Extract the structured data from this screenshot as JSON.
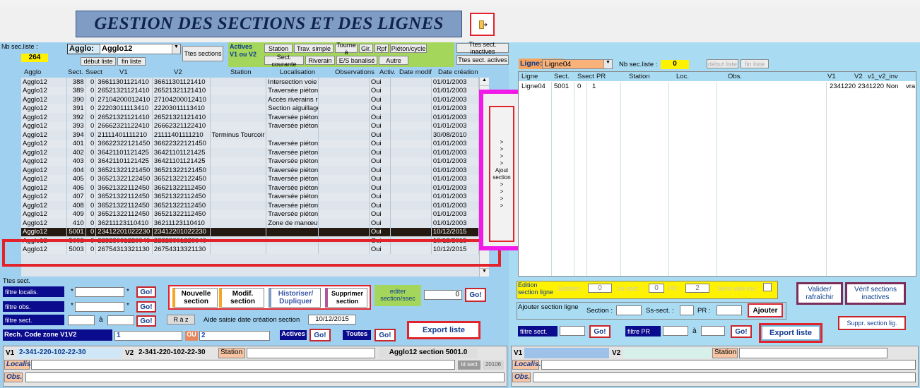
{
  "title": "GESTION DES SECTIONS ET DES LIGNES",
  "left": {
    "nb_label": "Nb sec.liste :",
    "nb_value": "264",
    "agglo_label": "Agglo:",
    "agglo_value": "Agglo12",
    "debut": "début liste",
    "fin": "fin liste",
    "ttes_sections": "Ttes sections",
    "actives_label": "Actives\nV1 ou V2",
    "filters1": [
      "Station",
      "Trav. simple",
      "Tourne à",
      "Gir.",
      "Rpf",
      "Piéton/cycle"
    ],
    "filters2": [
      "Sect. courante",
      "Riverain",
      "E/S banalisé",
      "Autre"
    ],
    "ttes_inactives": "Ttes sect. inactives",
    "ttes_actives": "Ttes sect. actives",
    "headers": [
      "Agglo",
      "Sect.",
      "Ssect",
      "V1",
      "V2",
      "Station",
      "Localisation",
      "Observations",
      "Activ.",
      "Date modif",
      "Date création"
    ],
    "rows": [
      [
        "Agglo12",
        "388",
        "0",
        "36611301121410",
        "36611301121410",
        "",
        "Intersection voie c",
        "",
        "Oui",
        "",
        "01/01/2003"
      ],
      [
        "Agglo12",
        "389",
        "0",
        "26521321121410",
        "26521321121410",
        "",
        "Traversée piétonr",
        "",
        "Oui",
        "",
        "01/01/2003"
      ],
      [
        "Agglo12",
        "390",
        "0",
        "27104200012410",
        "27104200012410",
        "",
        "Accès riverains ru",
        "",
        "Oui",
        "",
        "01/01/2003"
      ],
      [
        "Agglo12",
        "391",
        "0",
        "22203011113410",
        "22203011113410",
        "",
        "Section aiguillage",
        "",
        "Oui",
        "",
        "01/01/2003"
      ],
      [
        "Agglo12",
        "392",
        "0",
        "26521321121410",
        "26521321121410",
        "",
        "Traversée piétonr",
        "",
        "Oui",
        "",
        "01/01/2003"
      ],
      [
        "Agglo12",
        "393",
        "0",
        "26662321122410",
        "26662321122410",
        "",
        "Traversée piétonr",
        "",
        "Oui",
        "",
        "01/01/2003"
      ],
      [
        "Agglo12",
        "394",
        "0",
        "21111401111210",
        "21111401111210",
        "Terminus Tourcoir",
        "",
        "",
        "Oui",
        "",
        "30/08/2010"
      ],
      [
        "Agglo12",
        "401",
        "0",
        "36622322121450",
        "36622322121450",
        "",
        "Traversée piétonr",
        "",
        "Oui",
        "",
        "01/01/2003"
      ],
      [
        "Agglo12",
        "402",
        "0",
        "36421101121425",
        "36421101121425",
        "",
        "Traversée piétonr",
        "",
        "Oui",
        "",
        "01/01/2003"
      ],
      [
        "Agglo12",
        "403",
        "0",
        "36421101121425",
        "36421101121425",
        "",
        "Traversée piétonr",
        "",
        "Oui",
        "",
        "01/01/2003"
      ],
      [
        "Agglo12",
        "404",
        "0",
        "36521322121450",
        "36521322121450",
        "",
        "Traversée piétonr",
        "",
        "Oui",
        "",
        "01/01/2003"
      ],
      [
        "Agglo12",
        "405",
        "0",
        "36521322122450",
        "36521322122450",
        "",
        "Traversée piétonr",
        "",
        "Oui",
        "",
        "01/01/2003"
      ],
      [
        "Agglo12",
        "406",
        "0",
        "36621322112450",
        "36621322112450",
        "",
        "Traversée piétonr",
        "",
        "Oui",
        "",
        "01/01/2003"
      ],
      [
        "Agglo12",
        "407",
        "0",
        "36521322112450",
        "36521322112450",
        "",
        "Traversée piétonr",
        "",
        "Oui",
        "",
        "01/01/2003"
      ],
      [
        "Agglo12",
        "408",
        "0",
        "36521322112450",
        "36521322112450",
        "",
        "Traversée piétonr",
        "",
        "Oui",
        "",
        "01/01/2003"
      ],
      [
        "Agglo12",
        "409",
        "0",
        "36521322112450",
        "36521322112450",
        "",
        "Traversée piétonr",
        "",
        "Oui",
        "",
        "01/01/2003"
      ],
      [
        "Agglo12",
        "410",
        "0",
        "36211123110410",
        "36211123110410",
        "",
        "Zone de manœuv",
        "",
        "Oui",
        "",
        "01/01/2003"
      ],
      [
        "Agglo12",
        "5001",
        "0",
        "23412201022230",
        "23412201022230",
        "",
        "",
        "",
        "Oui",
        "",
        "10/12/2015"
      ],
      [
        "Agglo12",
        "5002",
        "0",
        "22323001220040",
        "22323001220040",
        "",
        "",
        "",
        "Oui",
        "",
        "10/12/2015"
      ],
      [
        "Agglo12",
        "5003",
        "0",
        "26754313321130",
        "26754313321130",
        "",
        "",
        "",
        "Oui",
        "",
        "10/12/2015"
      ]
    ],
    "ttes_sect": "Ttes sect.",
    "filtre_localis": "filtre localis.",
    "filtre_obs": "filtre obs.",
    "filtre_sect": "filtre sect.",
    "star": "*",
    "a": "à",
    "go": "Go!",
    "nouvelle": "Nouvelle\nsection",
    "modif": "Modif.\nsection",
    "historiser": "Historiser/\nDupliquer",
    "supprimer": "Supprimer\nsection",
    "editer": "editer\nsection/ssec",
    "editer_value": "0",
    "raz": "R à z",
    "aide": "Aide saisie date création section",
    "aide_date": "10/12/2015",
    "rech": "Rech. Code zone V1V2",
    "rech_v1": "1",
    "ou": "OU",
    "rech_v2": "2",
    "actives": "Actives",
    "toutes": "Toutes",
    "export": "Export liste",
    "v1_label": "V1",
    "v1_value": "2-341-220-102-22-30",
    "v2_label": "V2",
    "v2_value": "2-341-220-102-22-30",
    "station_label": "Station",
    "section_info": "Agglo12  section  5001.0",
    "id_sect_label": "Id sect",
    "id_sect_value": "20106",
    "localis_label": "Localis.",
    "obs_label": "Obs."
  },
  "mid": {
    "ajout": [
      ">",
      ">",
      ">",
      ">",
      "Ajout",
      "section",
      ">",
      ">",
      ">",
      ">"
    ]
  },
  "right": {
    "ligne_label": "Ligne:",
    "ligne_value": "Ligne04",
    "nb_label": "Nb sec.liste :",
    "nb_value": "0",
    "debut": "début liste",
    "fin": "fin liste",
    "headers": [
      "Ligne",
      "Sect.",
      "Ssect",
      "PR",
      "Station",
      "Loc.",
      "Obs.",
      "V1",
      "V2",
      "v1_v2_inv"
    ],
    "row": [
      "Ligne04",
      "5001",
      "0",
      "1",
      "",
      "",
      "",
      "2341220",
      "2341220",
      "Non",
      "vra"
    ],
    "edition": "Edition\nsection ligne",
    "section_lbl": "Section :",
    "section_val": "0",
    "ssect_lbl": "Ss-sect. :",
    "ssect_val": "0",
    "pr_lbl": "PR :",
    "pr_val": "2",
    "sens_lbl": "Sens voie inv.:",
    "valider": "Valider/\nrafraîchir",
    "verif": "Vérif sections\ninactives",
    "ajouter_section_ligne": "Ajouter section ligne",
    "ajout_section": "Section :",
    "ajout_ssect": "Ss-sect. :",
    "ajout_pr": "PR :",
    "ajouter": "Ajouter",
    "suppr": "Suppr. section lig.",
    "filtre_sect": "filtre sect.",
    "filtre_pr": "filtre PR",
    "a": "à",
    "go": "Go!",
    "export": "Export liste",
    "v1": "V1",
    "v2": "V2",
    "station": "Station",
    "localis": "Localis.",
    "obs": "Obs."
  },
  "colors": {
    "accent_red": "#e2232b",
    "magenta": "#f21ae8",
    "yellow": "#fff200",
    "navy": "#0b0b8e"
  }
}
